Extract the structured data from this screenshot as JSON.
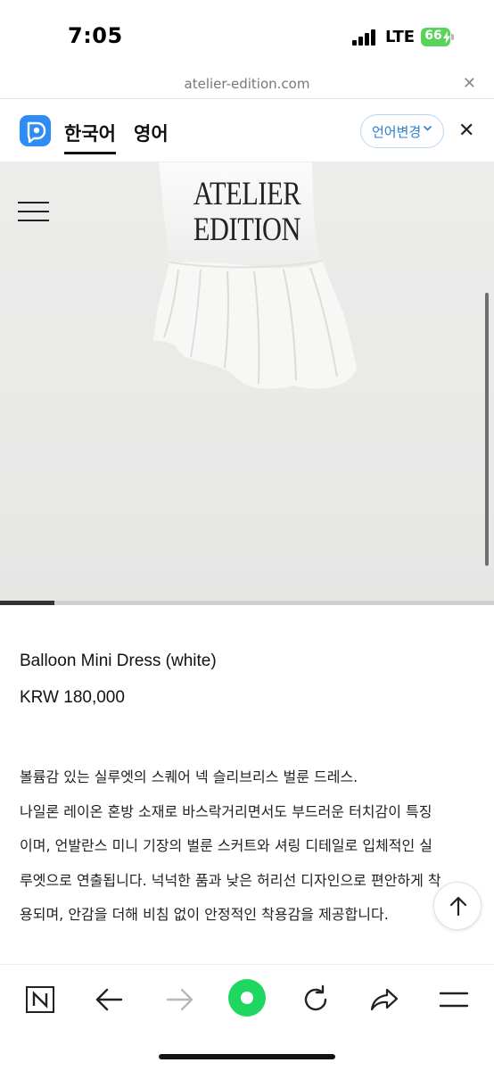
{
  "status_bar": {
    "time": "7:05",
    "network": "LTE",
    "battery": "66"
  },
  "browser": {
    "url": "atelier-edition.com",
    "close_icon": "close-icon"
  },
  "translate_bar": {
    "tabs": [
      {
        "label": "한국어",
        "active": true
      },
      {
        "label": "영어",
        "active": false
      }
    ],
    "change_language_label": "언어변경",
    "accent_color": "#2a7fd4"
  },
  "site": {
    "brand_line1": "ATELIER",
    "brand_line2": "EDITION",
    "hero_progress": 0.11
  },
  "product": {
    "name": "Balloon Mini Dress (white)",
    "price": "KRW 180,000",
    "description_lines": [
      "볼륨감 있는 실루엣의 스퀘어 넥 슬리브리스 벌룬 드레스.",
      "나일론 레이온 혼방 소재로 바스락거리면서도 부드러운 터치감이 특징",
      "이며, 언발란스 미니 기장의 벌룬 스커트와 셔링 디테일로 입체적인 실",
      "루엣으로 연출됩니다. 넉넉한 품과 낮은 허리선 디자인으로 편안하게 착",
      "용되며, 안감을 더해 비침 없이 안정적인 착용감을 제공합니다."
    ]
  },
  "toolbar": {
    "items": [
      "naver-icon",
      "back-arrow-icon",
      "forward-arrow-icon",
      "green-dot-icon",
      "reload-icon",
      "share-icon",
      "menu-icon"
    ],
    "green_color": "#1ed760"
  }
}
